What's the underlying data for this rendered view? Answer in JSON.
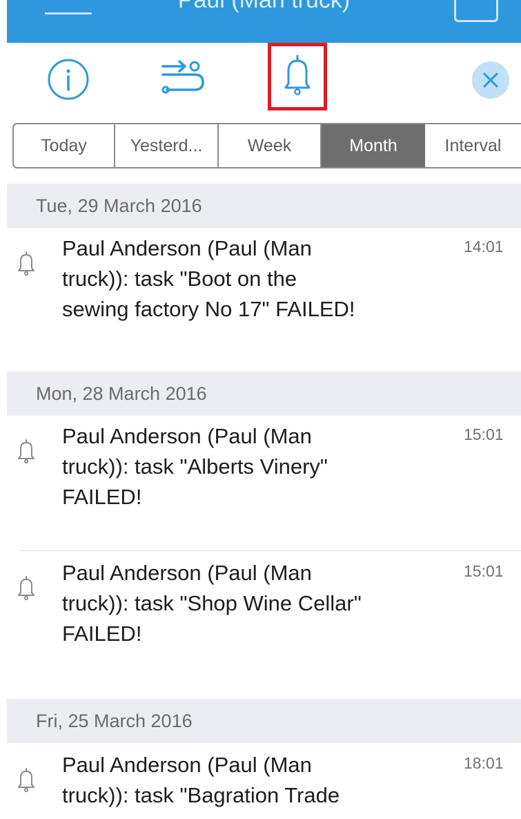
{
  "header": {
    "title": "Paul (Man truck)"
  },
  "toolbar": {
    "icons": [
      "info-icon",
      "route-icon",
      "bell-icon",
      "close-icon"
    ],
    "selected": "bell-icon",
    "highlight_color": "#e01b24"
  },
  "filter": {
    "options": [
      "Today",
      "Yesterd...",
      "Week",
      "Month",
      "Interval"
    ],
    "selected": "Month"
  },
  "groups": [
    {
      "date": "Tue, 29 March 2016",
      "items": [
        {
          "lines": [
            "Paul Anderson (Paul (Man",
            "truck)): task \"Boot on the",
            "sewing factory No 17\" FAILED!"
          ],
          "time": "14:01"
        }
      ]
    },
    {
      "date": "Mon, 28 March 2016",
      "items": [
        {
          "lines": [
            "Paul Anderson (Paul (Man",
            "truck)): task \"Alberts Vinery\"",
            "FAILED!"
          ],
          "time": "15:01"
        },
        {
          "lines": [
            "Paul Anderson (Paul (Man",
            "truck)): task \"Shop Wine Cellar\"",
            "FAILED!"
          ],
          "time": "15:01"
        }
      ]
    },
    {
      "date": "Fri, 25 March 2016",
      "items": [
        {
          "lines": [
            "Paul Anderson (Paul (Man",
            "truck)): task \"Bagration Trade"
          ],
          "time": "18:01"
        }
      ]
    }
  ],
  "colors": {
    "header_bg": "#2f97dd",
    "accent": "#2f97dd",
    "date_header_bg": "#ecedf2",
    "segment_active_bg": "#6e6e6e"
  }
}
